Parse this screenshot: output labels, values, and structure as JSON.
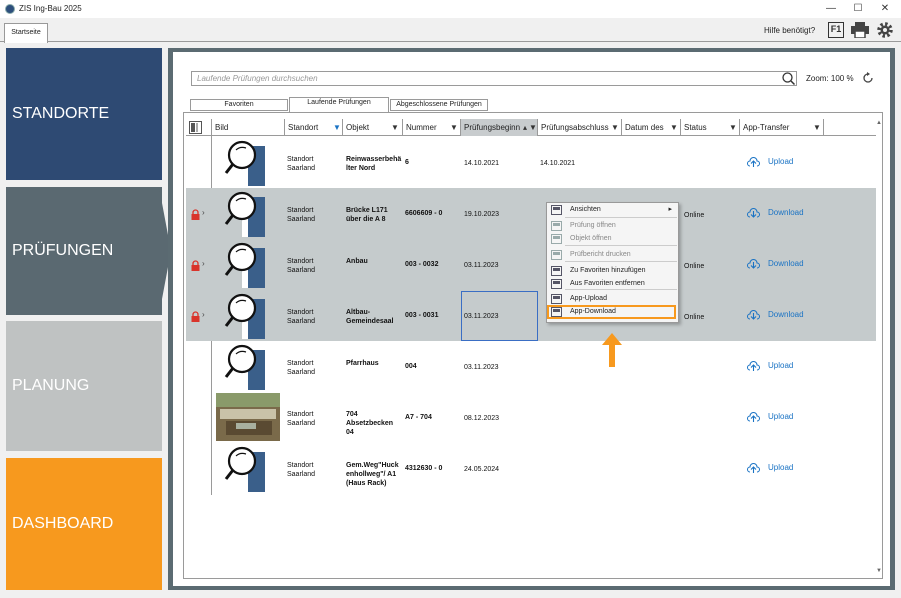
{
  "window": {
    "title": "ZIS Ing-Bau 2025",
    "minimize": "—",
    "maximize": "☐",
    "close": "✕"
  },
  "tabbar": {
    "start_tab": "Startseite",
    "help_label": "Hilfe benötigt?",
    "f1_label": "F1"
  },
  "nav": {
    "standorte": "STANDORTE",
    "pruefungen": "PRÜFUNGEN",
    "planung": "PLANUNG",
    "dashboard": "DASHBOARD"
  },
  "search": {
    "placeholder": "Laufende Prüfungen durchsuchen",
    "zoom_label": "Zoom:  100 %"
  },
  "subtabs": {
    "fav": "Favoriten",
    "laufend": "Laufende Prüfungen",
    "abgeschl": "Abgeschlossene Prüfungen"
  },
  "columns": [
    "Bild",
    "Standort",
    "Objekt",
    "Nummer",
    "Prüfungsbeginn",
    "Prüfungsabschluss",
    "Datum des",
    "Status",
    "App-Transfer"
  ],
  "rows": [
    {
      "standort": "Standort Saarland",
      "objekt": "Reinwasserbehä lter Nord",
      "nummer": "6",
      "beginn": "14.10.2021",
      "abschluss": "14.10.2021",
      "status": "",
      "transfer": "Upload",
      "locked": false,
      "selected": false
    },
    {
      "standort": "Standort Saarland",
      "objekt": "Brücke L171 über die A 8",
      "nummer": "6606609 - 0",
      "beginn": "19.10.2023",
      "abschluss": "",
      "status": "Online",
      "transfer": "Download",
      "locked": true,
      "selected": true
    },
    {
      "standort": "Standort Saarland",
      "objekt": "Anbau",
      "nummer": "003 - 0032",
      "beginn": "03.11.2023",
      "abschluss": "",
      "status": "Online",
      "transfer": "Download",
      "locked": true,
      "selected": true
    },
    {
      "standort": "Standort Saarland",
      "objekt": "Altbau-Gemeindesaal",
      "nummer": "003 - 0031",
      "beginn": "03.11.2023",
      "abschluss": "",
      "status": "Online",
      "transfer": "Download",
      "locked": true,
      "selected": true
    },
    {
      "standort": "Standort Saarland",
      "objekt": "Pfarrhaus",
      "nummer": "004",
      "beginn": "03.11.2023",
      "abschluss": "",
      "status": "",
      "transfer": "Upload",
      "locked": false,
      "selected": false
    },
    {
      "standort": "Standort Saarland",
      "objekt": "704 Absetzbecken 04",
      "nummer": "A7 - 704",
      "beginn": "08.12.2023",
      "abschluss": "",
      "status": "",
      "transfer": "Upload",
      "locked": false,
      "selected": false
    },
    {
      "standort": "Standort Saarland",
      "objekt": "Gem.Weg\"Huck enhollweg\"/ A1 (Haus Rack)",
      "nummer": "4312630 - 0",
      "beginn": "24.05.2024",
      "abschluss": "",
      "status": "",
      "transfer": "Upload",
      "locked": false,
      "selected": false
    }
  ],
  "context_menu": {
    "items": [
      {
        "label": "Ansichten",
        "disabled": false,
        "submenu": "▸"
      },
      {
        "label": "Prüfung öffnen",
        "disabled": true
      },
      {
        "label": "Objekt öffnen",
        "disabled": true
      },
      {
        "label": "Prüfbericht drucken",
        "disabled": true
      },
      {
        "label": "Zu Favoriten hinzufügen",
        "disabled": false
      },
      {
        "label": "Aus Favoriten entfernen",
        "disabled": false
      },
      {
        "label": "App-Upload",
        "disabled": false
      },
      {
        "label": "App-Download",
        "disabled": false
      }
    ]
  },
  "colors": {
    "accent_orange": "#f7991e",
    "nav_blue": "#2e4a73",
    "link_blue": "#1a73c4",
    "lock_red": "#d9342b"
  }
}
